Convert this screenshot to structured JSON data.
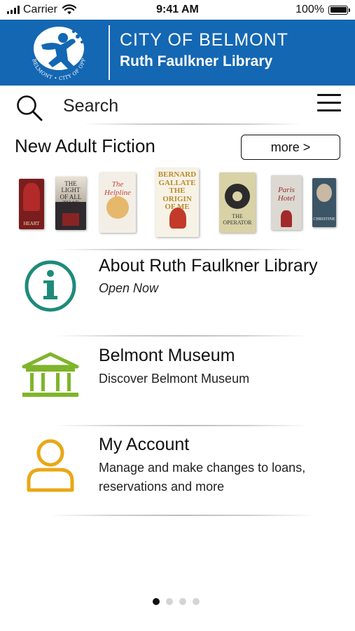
{
  "status_bar": {
    "carrier": "Carrier",
    "time": "9:41 AM",
    "battery": "100%"
  },
  "header": {
    "title": "CITY OF BELMONT",
    "subtitle": "Ruth Faulkner Library",
    "logo_text": "BELMONT • CITY OF OPPORTUNITY",
    "logo_name": "city-of-belmont-logo"
  },
  "search": {
    "placeholder": "Search",
    "icon": "search-icon"
  },
  "menu": {
    "icon": "hamburger-menu-icon"
  },
  "new_fiction": {
    "title": "New Adult Fiction",
    "more_label": "more >",
    "books": [
      {
        "cover_text": "HEART",
        "bg": "#7a1d1d",
        "fg": "#f2e2c8"
      },
      {
        "cover_text": "THE LIGHT OF ALL THAT FALLS",
        "bg": "#2f2a2e",
        "fg": "#f5f0e6"
      },
      {
        "cover_text": "The Helpline",
        "bg": "#f3eee6",
        "fg": "#c2473a"
      },
      {
        "cover_text": "BERNARD GALLATE THE ORIGIN OF ME",
        "bg": "#f7f2e6",
        "fg": "#b98a2c"
      },
      {
        "cover_text": "THE OPERATOR",
        "bg": "#d8d2a6",
        "fg": "#333"
      },
      {
        "cover_text": "Paris Hotel",
        "bg": "#dcd9d2",
        "fg": "#9a2a2a"
      },
      {
        "cover_text": "CHRISTINE",
        "bg": "#3c5566",
        "fg": "#f0f0f0"
      }
    ]
  },
  "list": [
    {
      "title": "About Ruth Faulkner Library",
      "subtitle": "Open Now",
      "icon": "info-icon",
      "color": "#1e8a7a"
    },
    {
      "title": "Belmont Museum",
      "subtitle": "Discover Belmont Museum",
      "icon": "museum-building-icon",
      "color": "#7fb52a"
    },
    {
      "title": "My Account",
      "subtitle": "Manage and make changes to loans, reservations and more",
      "icon": "user-account-icon",
      "color": "#e8a817"
    }
  ],
  "pagination": {
    "total": 4,
    "active": 1
  },
  "colors": {
    "header_blue": "#1467b3",
    "info_teal": "#1e8a7a",
    "museum_green": "#7fb52a",
    "account_yellow": "#e8a817"
  }
}
